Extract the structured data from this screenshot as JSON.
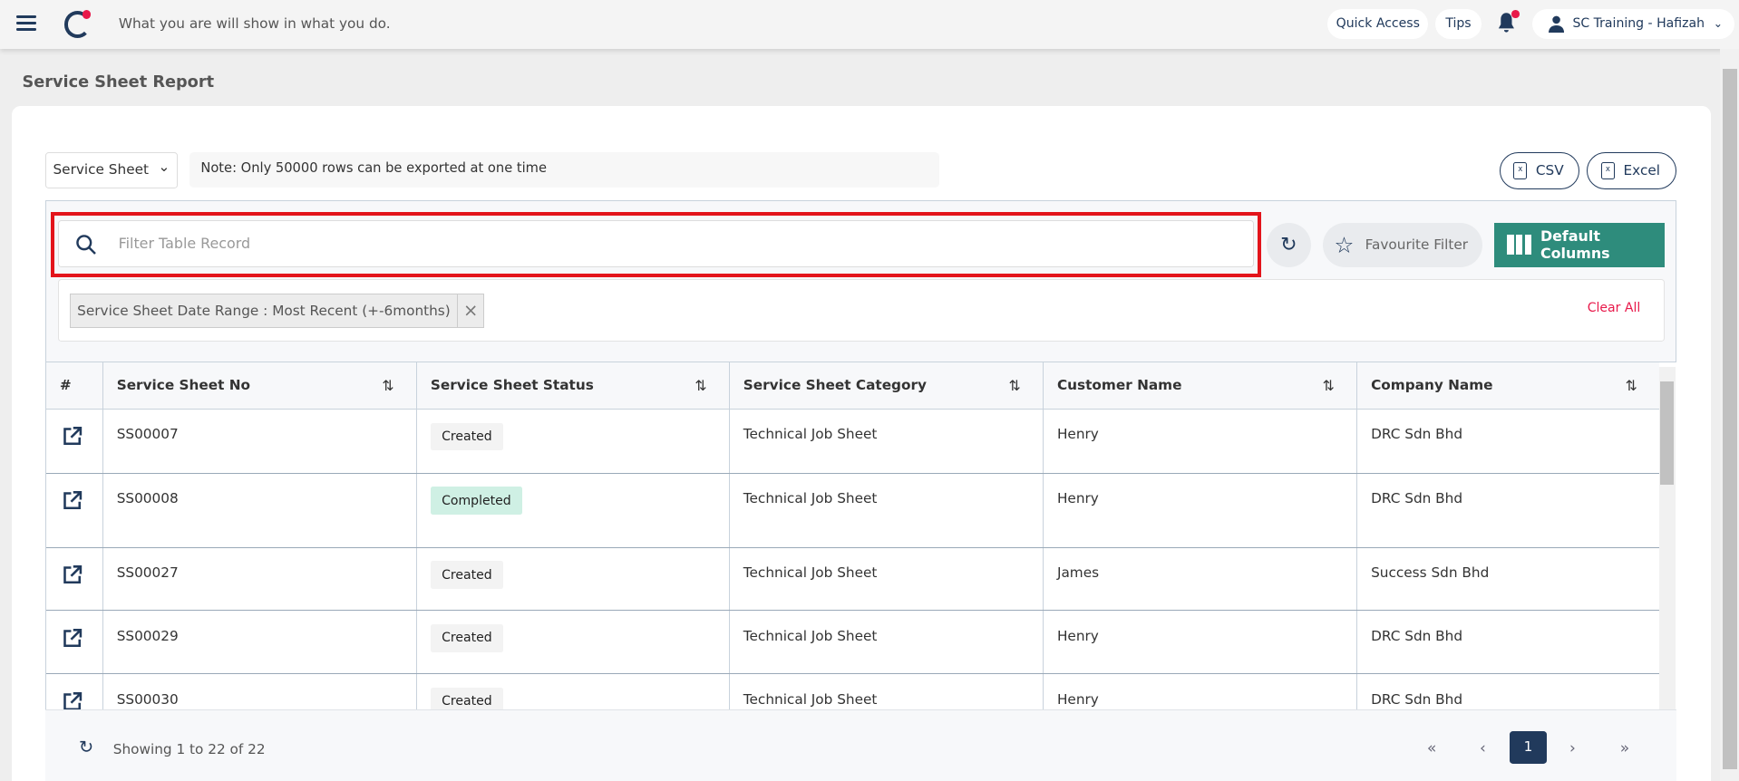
{
  "header": {
    "tagline": "What you are will show in what you do.",
    "quick_access": "Quick Access",
    "tips": "Tips",
    "user": "SC Training - Hafizah"
  },
  "page": {
    "title": "Service Sheet Report"
  },
  "toolbar": {
    "report_select": "Service Sheet",
    "note": "Note: Only 50000 rows can be exported at one time",
    "csv": "CSV",
    "excel": "Excel"
  },
  "filter": {
    "placeholder": "Filter Table Record",
    "favourite": "Favourite Filter",
    "default_columns": "Default Columns",
    "chip": "Service Sheet Date Range : Most Recent (+-6months)",
    "clear_all": "Clear All"
  },
  "table": {
    "headers": [
      "#",
      "Service Sheet No",
      "Service Sheet Status",
      "Service Sheet Category",
      "Customer Name",
      "Company Name"
    ],
    "rows": [
      {
        "no": "SS00007",
        "status": "Created",
        "category": "Technical Job Sheet",
        "customer": "Henry",
        "company": "DRC Sdn Bhd"
      },
      {
        "no": "SS00008",
        "status": "Completed",
        "category": "Technical Job Sheet",
        "customer": "Henry",
        "company": "DRC Sdn Bhd"
      },
      {
        "no": "SS00027",
        "status": "Created",
        "category": "Technical Job Sheet",
        "customer": "James",
        "company": "Success Sdn Bhd"
      },
      {
        "no": "SS00029",
        "status": "Created",
        "category": "Technical Job Sheet",
        "customer": "Henry",
        "company": "DRC Sdn Bhd"
      },
      {
        "no": "SS00030",
        "status": "Created",
        "category": "Technical Job Sheet",
        "customer": "Henry",
        "company": "DRC Sdn Bhd"
      }
    ]
  },
  "footer": {
    "showing": "Showing 1 to 22 of 22",
    "current_page": "1"
  },
  "colors": {
    "brand": "#213a5c",
    "accent": "#e8194a",
    "teal": "#2e8c7c",
    "highlight": "#e3141b"
  }
}
